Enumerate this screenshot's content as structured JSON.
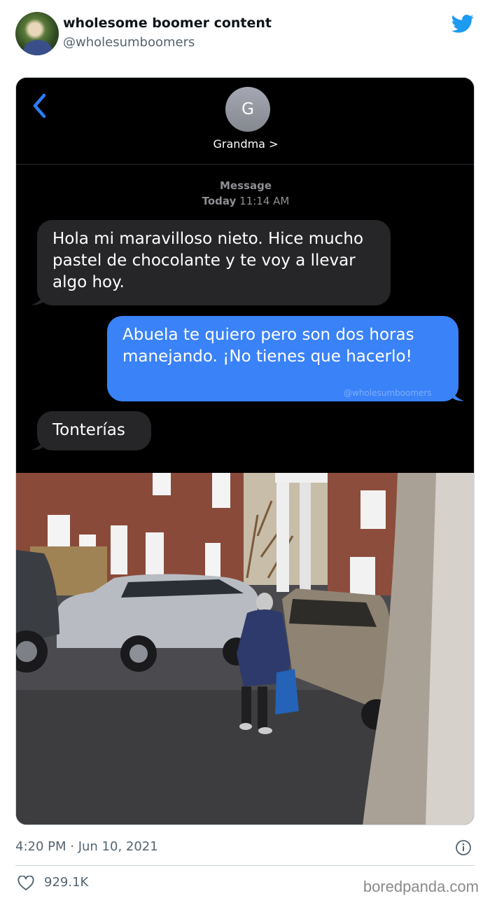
{
  "tweet": {
    "display_name": "wholesome boomer content",
    "handle": "@wholesumboomers",
    "timestamp": "4:20 PM · Jun 10, 2021",
    "likes": "929.1K",
    "source_watermark": "boredpanda.com"
  },
  "phone": {
    "contact_initial": "G",
    "contact_name": "Grandma >",
    "service_label": "Message",
    "time_day": "Today",
    "time_clock": "11:14 AM",
    "messages": [
      {
        "direction": "incoming",
        "text": "Hola mi maravilloso nieto. Hice mucho pastel de chocolante y te voy a llevar algo hoy."
      },
      {
        "direction": "outgoing",
        "text": "Abuela te quiero pero son dos horas manejando. ¡No tienes que hacerlo!"
      },
      {
        "direction": "incoming",
        "text": "Tonterías"
      }
    ],
    "watermark": "@wholesumboomers",
    "colors": {
      "incoming": "#262628",
      "outgoing": "#3a82f7",
      "background": "#000000"
    }
  },
  "icons": {
    "brand": "twitter-bird-icon",
    "back": "chevron-left-icon",
    "info": "info-icon",
    "like": "heart-icon"
  },
  "colors": {
    "twitter_blue": "#1d9bf0",
    "muted_text": "#536471"
  }
}
